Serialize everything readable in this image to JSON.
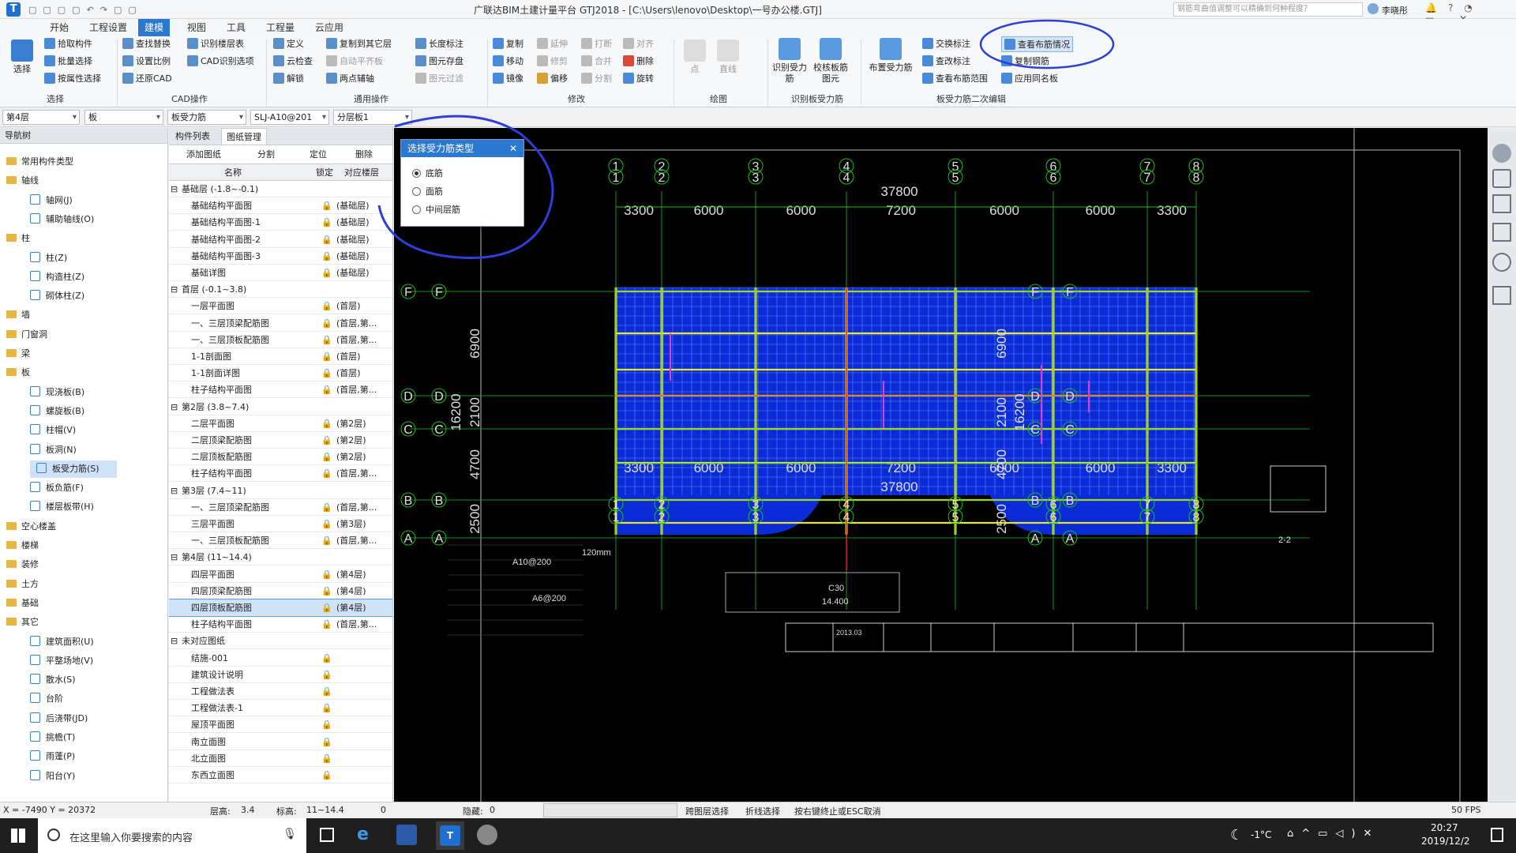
{
  "titlebar": {
    "title": "广联达BIM土建计量平台 GTJ2018 - [C:\\Users\\lenovo\\Desktop\\一号办公楼.GTJ]",
    "search_placeholder": "钢筋弯曲值调整可以精确到何种程度？",
    "user": "李晓彤"
  },
  "menu": [
    "开始",
    "工程设置",
    "建模",
    "视图",
    "工具",
    "工程量",
    "云应用"
  ],
  "menu_active": "建模",
  "ribbon": {
    "select_label": "选择",
    "col1": [
      "拾取构件",
      "批量选择",
      "按属性选择"
    ],
    "col2": [
      "查找替换",
      "设置比例",
      "还原CAD"
    ],
    "col3": [
      "识别楼层表",
      "CAD识别选项"
    ],
    "col4": [
      "定义",
      "云检查",
      "解锁"
    ],
    "col5": [
      "复制到其它层",
      "自动平齐板",
      "两点辅轴"
    ],
    "col6": [
      "长度标注",
      "图元存盘",
      "图元过滤"
    ],
    "col7": [
      "复制",
      "移动",
      "镜像"
    ],
    "col8": [
      "延伸",
      "修剪",
      "偏移"
    ],
    "col9": [
      "打断",
      "合并",
      "分割"
    ],
    "col10": [
      "对齐",
      "删除",
      "旋转"
    ],
    "draw_labels": [
      "点",
      "直线"
    ],
    "big1": "识别受力筋",
    "big2": "校核板筋图元",
    "big3": "布置受力筋",
    "col11": [
      "交换标注",
      "查改标注",
      "查看布筋范围"
    ],
    "col12": [
      "查看布筋情况",
      "复制钢筋",
      "应用同名板"
    ],
    "groups": [
      "选择",
      "CAD操作",
      "通用操作",
      "修改",
      "绘图",
      "识别板受力筋",
      "板受力筋二次编辑"
    ]
  },
  "selectors": [
    "第4层",
    "板",
    "板受力筋",
    "SLJ-A10@201",
    "分层板1"
  ],
  "nav": {
    "title": "导航树",
    "items": [
      {
        "t": "常用构件类型",
        "lv": 0
      },
      {
        "t": "轴线",
        "lv": 0
      },
      {
        "t": "轴网(J)",
        "lv": 1
      },
      {
        "t": "辅助轴线(O)",
        "lv": 1
      },
      {
        "t": "柱",
        "lv": 0
      },
      {
        "t": "柱(Z)",
        "lv": 1
      },
      {
        "t": "构造柱(Z)",
        "lv": 1
      },
      {
        "t": "砌体柱(Z)",
        "lv": 1
      },
      {
        "t": "墙",
        "lv": 0
      },
      {
        "t": "门窗洞",
        "lv": 0
      },
      {
        "t": "梁",
        "lv": 0
      },
      {
        "t": "板",
        "lv": 0
      },
      {
        "t": "现浇板(B)",
        "lv": 1
      },
      {
        "t": "螺旋板(B)",
        "lv": 1
      },
      {
        "t": "柱帽(V)",
        "lv": 1
      },
      {
        "t": "板洞(N)",
        "lv": 1
      },
      {
        "t": "板受力筋(S)",
        "lv": 1,
        "sel": true
      },
      {
        "t": "板负筋(F)",
        "lv": 1
      },
      {
        "t": "楼层板带(H)",
        "lv": 1
      },
      {
        "t": "空心楼盖",
        "lv": 0
      },
      {
        "t": "楼梯",
        "lv": 0
      },
      {
        "t": "装修",
        "lv": 0
      },
      {
        "t": "土方",
        "lv": 0
      },
      {
        "t": "基础",
        "lv": 0
      },
      {
        "t": "其它",
        "lv": 0
      },
      {
        "t": "建筑面积(U)",
        "lv": 1
      },
      {
        "t": "平整场地(V)",
        "lv": 1
      },
      {
        "t": "散水(S)",
        "lv": 1
      },
      {
        "t": "台阶",
        "lv": 1
      },
      {
        "t": "后浇带(JD)",
        "lv": 1
      },
      {
        "t": "挑檐(T)",
        "lv": 1
      },
      {
        "t": "雨蓬(P)",
        "lv": 1
      },
      {
        "t": "阳台(Y)",
        "lv": 1
      }
    ]
  },
  "drawings": {
    "tabs": [
      "构件列表",
      "图纸管理"
    ],
    "toolbar": [
      "添加图纸",
      "分割",
      "定位",
      "删除"
    ],
    "headers": [
      "名称",
      "锁定",
      "对应楼层"
    ],
    "rows": [
      {
        "g": true,
        "n": "基础层 (-1.8~-0.1)"
      },
      {
        "n": "基础结构平面图",
        "f": "(基础层)"
      },
      {
        "n": "基础结构平面图-1",
        "f": "(基础层)"
      },
      {
        "n": "基础结构平面图-2",
        "f": "(基础层)"
      },
      {
        "n": "基础结构平面图-3",
        "f": "(基础层)"
      },
      {
        "n": "基础详图",
        "f": "(基础层)"
      },
      {
        "g": true,
        "n": "首层 (-0.1~3.8)"
      },
      {
        "n": "一层平面图",
        "f": "(首层)"
      },
      {
        "n": "一、三层顶梁配筋图",
        "f": "(首层,第..."
      },
      {
        "n": "一、三层顶板配筋图",
        "f": "(首层,第..."
      },
      {
        "n": "1-1剖面图",
        "f": "(首层)"
      },
      {
        "n": "1-1剖面详图",
        "f": "(首层)"
      },
      {
        "n": "柱子结构平面图",
        "f": "(首层,第..."
      },
      {
        "g": true,
        "n": "第2层 (3.8~7.4)"
      },
      {
        "n": "二层平面图",
        "f": "(第2层)"
      },
      {
        "n": "二层顶梁配筋图",
        "f": "(第2层)"
      },
      {
        "n": "二层顶板配筋图",
        "f": "(第2层)"
      },
      {
        "n": "柱子结构平面图",
        "f": "(首层,第..."
      },
      {
        "g": true,
        "n": "第3层 (7.4~11)"
      },
      {
        "n": "一、三层顶梁配筋图",
        "f": "(首层,第..."
      },
      {
        "n": "三层平面图",
        "f": "(第3层)"
      },
      {
        "n": "一、三层顶板配筋图",
        "f": "(首层,第..."
      },
      {
        "g": true,
        "n": "第4层 (11~14.4)"
      },
      {
        "n": "四层平面图",
        "f": "(第4层)"
      },
      {
        "n": "四层顶梁配筋图",
        "f": "(第4层)"
      },
      {
        "n": "四层顶板配筋图",
        "f": "(第4层)",
        "sel": true
      },
      {
        "n": "柱子结构平面图",
        "f": "(首层,第..."
      },
      {
        "g": true,
        "n": "未对应图纸"
      },
      {
        "n": "结施-001",
        "f": ""
      },
      {
        "n": "建筑设计说明",
        "f": ""
      },
      {
        "n": "工程做法表",
        "f": ""
      },
      {
        "n": "工程做法表-1",
        "f": ""
      },
      {
        "n": "屋顶平面图",
        "f": ""
      },
      {
        "n": "南立面图",
        "f": ""
      },
      {
        "n": "北立面图",
        "f": ""
      },
      {
        "n": "东西立面图",
        "f": ""
      }
    ]
  },
  "dialog": {
    "title": "选择受力筋类型",
    "options": [
      "底筋",
      "面筋",
      "中间层筋"
    ],
    "selected": 0
  },
  "drawing": {
    "axis_nums": [
      "1",
      "2",
      "3",
      "4",
      "5",
      "6",
      "7",
      "8"
    ],
    "row_labels": [
      "F",
      "D",
      "C",
      "B",
      "A"
    ],
    "dims_top": [
      "3300",
      "6000",
      "6000",
      "7200",
      "6000",
      "6000",
      "3300"
    ],
    "total": "37800",
    "dims_left": [
      "6900",
      "2100",
      "4700",
      "2500"
    ],
    "left_total": "16200",
    "section": "2-2",
    "notes": [
      "120mm",
      "A10@200",
      "A6@200"
    ],
    "table_vals": [
      "C30",
      "14.400"
    ],
    "sheet_no": "2013.03"
  },
  "status": {
    "coords": "X = -7490 Y = 20372",
    "floor_h_label": "层高:",
    "floor_h": "3.4",
    "elev_label": "标高:",
    "elev": "11~14.4",
    "zero": "0",
    "hidden_label": "隐藏:",
    "hidden": "0",
    "btn1": "跨图层选择",
    "btn2": "折线选择",
    "hint": "按右键终止或ESC取消",
    "fps": "50 FPS"
  },
  "taskbar": {
    "search": "在这里输入你要搜索的内容",
    "temp": "-1°C",
    "time": "20:27",
    "date": "2019/12/2"
  }
}
